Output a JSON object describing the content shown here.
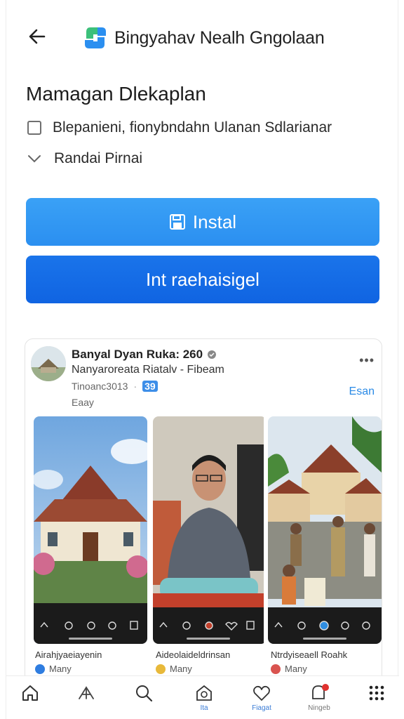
{
  "header": {
    "title": "Bingyahav Nealh Gngolaan",
    "back_icon": "arrow-left-icon",
    "logo_colors": [
      "#2b8ff0",
      "#3cc07a"
    ]
  },
  "section": {
    "title": "Mamagan Dlekaplan",
    "option1": "Blepanieni, fionybndahn Ulanan Sdlarianar",
    "option2": "Randai Pirnai"
  },
  "buttons": {
    "install_label": "Instal",
    "secondary_label": "Int raehaisigel"
  },
  "post": {
    "name": "Banyal Dyan Ruka: 260",
    "subtitle": "Nanyaroreata Riatalv - Fibeam",
    "meta": "Tinoanc3013",
    "meta_badge": "39",
    "meta2": "Eaay",
    "follow": "Esan",
    "more": "•••",
    "thumbs": [
      {
        "caption": "Airahjyaeiayenin",
        "author": "Many",
        "icon_color": "#2f7de0"
      },
      {
        "caption": "Aideolaideldrinsan",
        "author": "Many",
        "icon_color": "#e8b93a"
      },
      {
        "caption": "Ntrdyiseaell Roahk",
        "author": "Many",
        "icon_color": "#d9534f"
      }
    ]
  },
  "bottom_nav": {
    "items": [
      {
        "icon": "home-icon",
        "label": ""
      },
      {
        "icon": "share-icon",
        "label": ""
      },
      {
        "icon": "search-icon",
        "label": ""
      },
      {
        "icon": "upload-icon",
        "label": "Ita"
      },
      {
        "icon": "heart-icon",
        "label": "Fiagat"
      },
      {
        "icon": "notification-icon",
        "label": "Ningeb"
      },
      {
        "icon": "grid-icon",
        "label": ""
      }
    ]
  }
}
